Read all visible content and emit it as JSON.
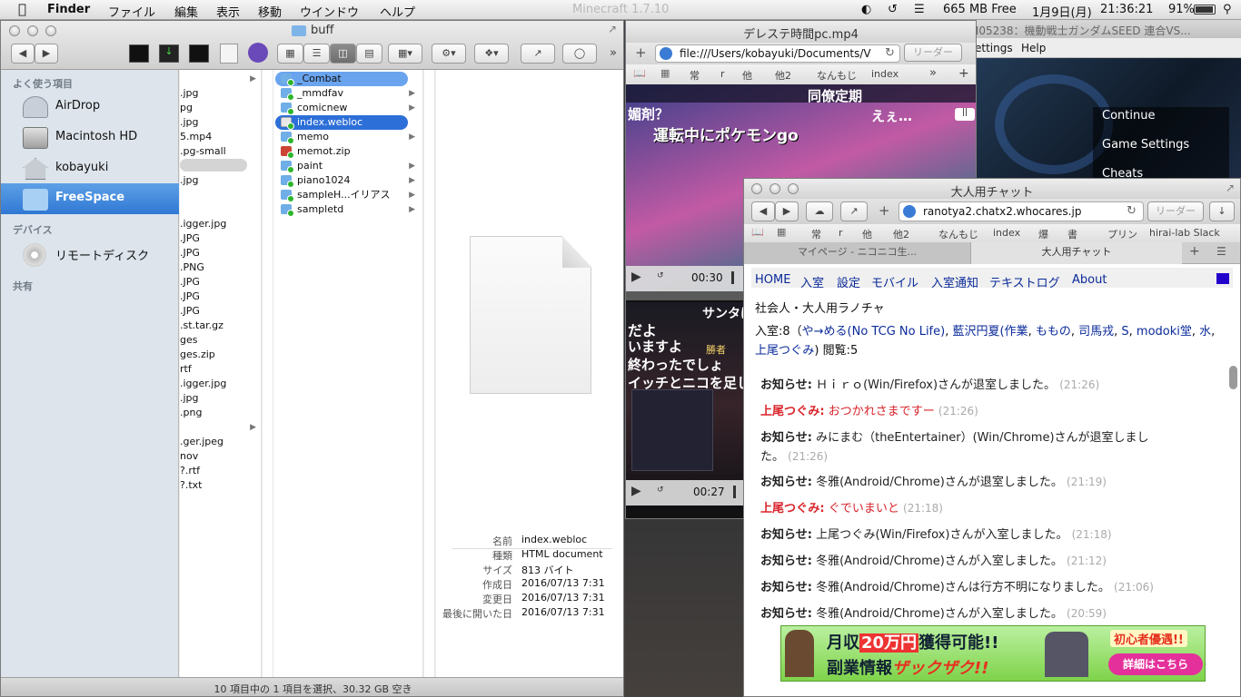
{
  "menubar": {
    "app": "Finder",
    "menus": [
      "ファイル",
      "編集",
      "表示",
      "移動",
      "ウインドウ",
      "ヘルプ"
    ],
    "background_title": "Minecraft 1.7.10",
    "memory": "665 MB Free",
    "date": "1月9日(月)",
    "time": "21:36:21",
    "battery": "91%"
  },
  "finder": {
    "title": "buff",
    "sidebar": {
      "favorites_header": "よく使う項目",
      "favorites": [
        "AirDrop",
        "Macintosh HD",
        "kobayuki",
        "FreeSpace"
      ],
      "devices_header": "デバイス",
      "devices": [
        "リモートディスク"
      ],
      "shared_header": "共有"
    },
    "col1": [
      ".jpg",
      "pg",
      ".jpg",
      "5.mp4",
      ".pg-small",
      "",
      ".jpg",
      "",
      ".igger.jpg",
      ".JPG",
      ".JPG",
      ".PNG",
      ".JPG",
      ".JPG",
      ".JPG",
      ".st.tar.gz",
      "ges",
      "ges.zip",
      "rtf",
      ".igger.jpg",
      ".jpg",
      ".png",
      "",
      ".ger.jpeg",
      "nov",
      "?.rtf",
      "?.txt"
    ],
    "col2": [
      "_Combat",
      "_mmdfav",
      "comicnew",
      "index.webloc",
      "memo",
      "memot.zip",
      "paint",
      "piano1024",
      "sampleH...イリアス",
      "sampletd"
    ],
    "info": {
      "labels": [
        "名前",
        "種類",
        "サイズ",
        "作成日",
        "変更日",
        "最後に開いた日"
      ],
      "values": [
        "index.webloc",
        "HTML document",
        "813 バイト",
        "2016/07/13 7:31",
        "2016/07/13 7:31",
        "2016/07/13 7:31"
      ]
    },
    "status": "10 項目中の 1 項目を選択、30.32 GB 空き"
  },
  "video_window": {
    "title": "デレステ時間pc.mp4",
    "url": "file:///Users/kobayuki/Documents/V",
    "reader": "リーダー",
    "favorites": [
      "常",
      "r",
      "他",
      "他2",
      "なんもじ",
      "index"
    ],
    "player1": {
      "time": "00:30",
      "caption1": "同僚定期",
      "caption2": "運転中にポケモンgo",
      "caption3": "えぇ…",
      "caption4": "媚剤？"
    },
    "player2": {
      "time": "00:27",
      "caption1": "サンタはア",
      "caption2": "だよ",
      "caption3": "いますよ",
      "caption4": "終わったでしょ",
      "caption5": "イッチとニコを足して",
      "caption6": "勝者"
    }
  },
  "back_window": {
    "title": "M05238：機動戦士ガンダムSEED 連合VS...",
    "menu": [
      "ettings",
      "Help"
    ],
    "game_menu": [
      "Continue",
      "Game Settings",
      "Cheats"
    ]
  },
  "chat_window": {
    "title": "大人用チャット",
    "url": "ranotya2.chatx2.whocares.jp",
    "reader": "リーダー",
    "favorites": [
      "常",
      "r",
      "他",
      "他2",
      "なんもじ",
      "index",
      "爆",
      "書",
      "プリン",
      "hirai-lab Slack"
    ],
    "tabs": [
      "マイページ - ニコニコ生...",
      "大人用チャット"
    ],
    "nav": [
      "HOME",
      "入室",
      "設定",
      "モバイル",
      "入室通知",
      "テキストログ",
      "About"
    ],
    "room_title": "社会人・大人用ラノチャ",
    "presence": {
      "prefix": "入室:8（",
      "members": [
        "や→める(No TCG No Life)",
        "藍沢円夏(作業",
        "ももの",
        "司馬戎",
        "S",
        "modoki堂",
        "水",
        "上尾つぐみ"
      ],
      "suffix": ") 閲覧:5"
    },
    "messages": [
      {
        "who": "お知らせ:",
        "text": "Ｈｉｒｏ(Win/Firefox)さんが退室しました。",
        "time": "(21:26)",
        "red": false
      },
      {
        "who": "上尾つぐみ:",
        "text": "おつかれさまですー",
        "time": "(21:26)",
        "red": true
      },
      {
        "who": "お知らせ:",
        "text": "みにまむ（theEntertainer）(Win/Chrome)さんが退室しまし",
        "text2": "た。",
        "time": "(21:26)",
        "red": false
      },
      {
        "who": "お知らせ:",
        "text": "冬雅(Android/Chrome)さんが退室しました。",
        "time": "(21:19)",
        "red": false
      },
      {
        "who": "上尾つぐみ:",
        "text": "ぐでいまいと",
        "time": "(21:18)",
        "red": true
      },
      {
        "who": "お知らせ:",
        "text": "上尾つぐみ(Win/Firefox)さんが入室しました。",
        "time": "(21:18)",
        "red": false
      },
      {
        "who": "お知らせ:",
        "text": "冬雅(Android/Chrome)さんが入室しました。",
        "time": "(21:12)",
        "red": false
      },
      {
        "who": "お知らせ:",
        "text": "冬雅(Android/Chrome)さんは行方不明になりました。",
        "time": "(21:06)",
        "red": false
      },
      {
        "who": "お知らせ:",
        "text": "冬雅(Android/Chrome)さんが入室しました。",
        "time": "(20:59)",
        "red": false
      }
    ],
    "ad": {
      "line1a": "月収",
      "line1b": "20万円",
      "line1c": "獲得可能!!",
      "line2a": "副業情報",
      "line2b": "ザックザク!!",
      "badge": "初心者優遇!!",
      "button": "詳細はこちら"
    }
  }
}
